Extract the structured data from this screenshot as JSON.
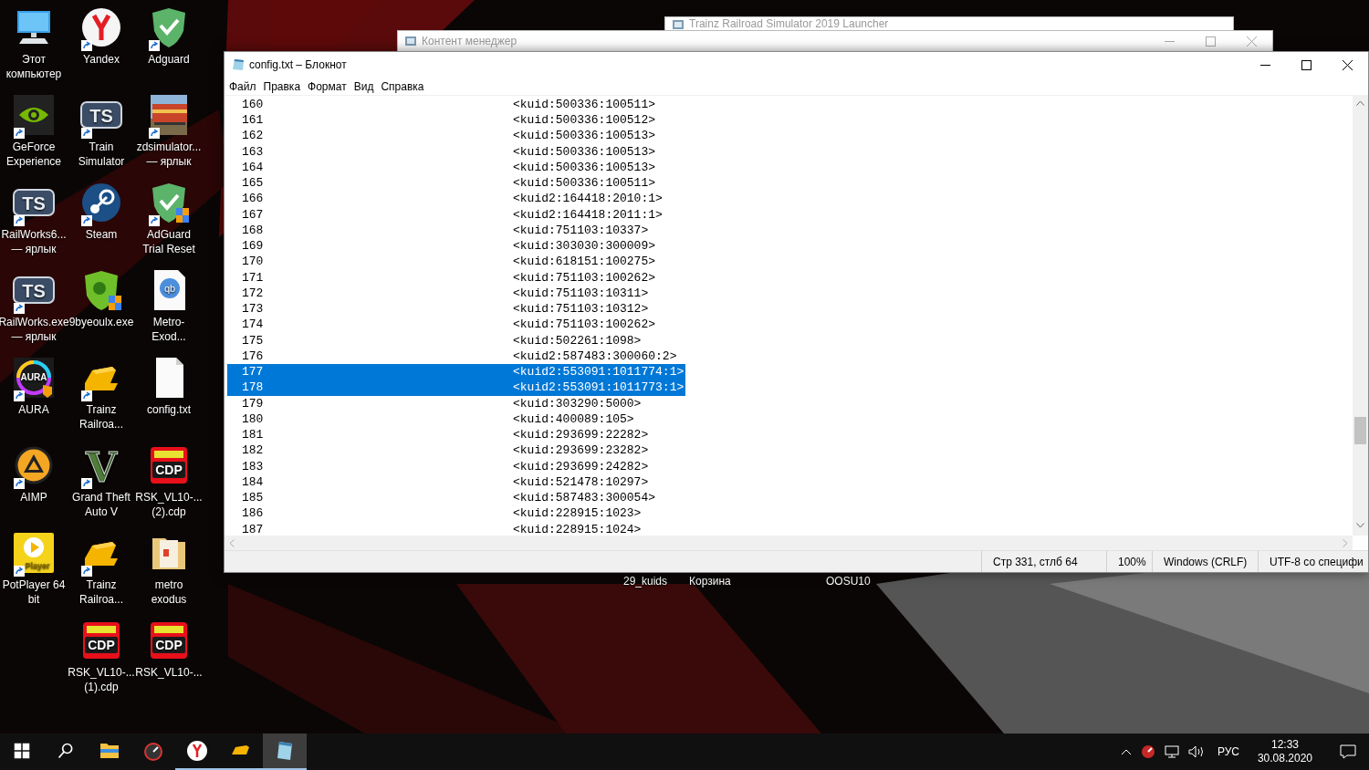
{
  "desktop": {
    "columns": [
      [
        {
          "label": "Этот компьютер",
          "kind": "computer",
          "shortcut": false
        },
        {
          "label": "GeForce Experience",
          "kind": "nvidia",
          "shortcut": true
        },
        {
          "label": "RailWorks6... — ярлык",
          "kind": "ts",
          "badge": "TS",
          "shortcut": true
        },
        {
          "label": "RailWorks.exe — ярлык",
          "kind": "ts",
          "badge": "TS",
          "shortcut": true
        },
        {
          "label": "AURA",
          "kind": "aura",
          "badge": "AURA",
          "shortcut": true
        },
        {
          "label": "AIMP",
          "kind": "aimp",
          "shortcut": true
        },
        {
          "label": "PotPlayer 64 bit",
          "kind": "potplayer",
          "badge": "Player",
          "shortcut": true
        }
      ],
      [
        {
          "label": "Yandex",
          "kind": "yandex",
          "shortcut": true
        },
        {
          "label": "Train Simulator",
          "kind": "ts",
          "badge": "TS",
          "shortcut": true
        },
        {
          "label": "Steam",
          "kind": "steam",
          "shortcut": true
        },
        {
          "label": "9byeoulx.exe",
          "kind": "drweb",
          "shortcut": false
        },
        {
          "label": "Trainz Railroa...",
          "kind": "trainz",
          "shortcut": true
        },
        {
          "label": "Grand Theft Auto V",
          "kind": "gta",
          "badge": "V",
          "shortcut": true
        },
        {
          "label": "Trainz Railroa...",
          "kind": "trainz",
          "shortcut": true
        },
        {
          "label": "RSK_VL10-... (1).cdp",
          "kind": "cdp",
          "badge": "CDP",
          "shortcut": false
        }
      ],
      [
        {
          "label": "Adguard",
          "kind": "adguard",
          "shortcut": true
        },
        {
          "label": "zdsimulator... — ярлык",
          "shortcut": true
        },
        {
          "label": "AdGuard Trial Reset",
          "kind": "adguard-uac",
          "shortcut": true
        },
        {
          "label": "Metro-Exod...",
          "kind": "qb",
          "badge": "qb",
          "shortcut": false
        },
        {
          "label": "config.txt",
          "kind": "textfile",
          "shortcut": false
        },
        {
          "label": "RSK_VL10-... (2).cdp",
          "kind": "cdp",
          "badge": "CDP",
          "shortcut": false
        },
        {
          "label": "metro exodus",
          "kind": "folder",
          "shortcut": false
        },
        {
          "label": "RSK_VL10-...",
          "kind": "cdp",
          "badge": "CDP",
          "shortcut": false
        }
      ]
    ],
    "hidden_labels": [
      "29_kuids",
      "Корзина",
      "OOSU10"
    ]
  },
  "background_windows": [
    {
      "title": "Trainz Railroad Simulator 2019 Launcher"
    },
    {
      "title": "Контент менеджер"
    }
  ],
  "notepad": {
    "title": "config.txt – Блокнот",
    "menu": [
      "Файл",
      "Правка",
      "Формат",
      "Вид",
      "Справка"
    ],
    "lines": [
      {
        "number": "160",
        "text": "<kuid:500336:100511>",
        "selected": false
      },
      {
        "number": "161",
        "text": "<kuid:500336:100512>",
        "selected": false
      },
      {
        "number": "162",
        "text": "<kuid:500336:100513>",
        "selected": false
      },
      {
        "number": "163",
        "text": "<kuid:500336:100513>",
        "selected": false
      },
      {
        "number": "164",
        "text": "<kuid:500336:100513>",
        "selected": false
      },
      {
        "number": "165",
        "text": "<kuid:500336:100511>",
        "selected": false
      },
      {
        "number": "166",
        "text": "<kuid2:164418:2010:1>",
        "selected": false
      },
      {
        "number": "167",
        "text": "<kuid2:164418:2011:1>",
        "selected": false
      },
      {
        "number": "168",
        "text": "<kuid:751103:10337>",
        "selected": false
      },
      {
        "number": "169",
        "text": "<kuid:303030:300009>",
        "selected": false
      },
      {
        "number": "170",
        "text": "<kuid:618151:100275>",
        "selected": false
      },
      {
        "number": "171",
        "text": "<kuid:751103:100262>",
        "selected": false
      },
      {
        "number": "172",
        "text": "<kuid:751103:10311>",
        "selected": false
      },
      {
        "number": "173",
        "text": "<kuid:751103:10312>",
        "selected": false
      },
      {
        "number": "174",
        "text": "<kuid:751103:100262>",
        "selected": false
      },
      {
        "number": "175",
        "text": "<kuid:502261:1098>",
        "selected": false
      },
      {
        "number": "176",
        "text": "<kuid2:587483:300060:2>",
        "selected": false
      },
      {
        "number": "177",
        "text": "<kuid2:553091:1011774:1>",
        "selected": true
      },
      {
        "number": "178",
        "text": "<kuid2:553091:1011773:1>",
        "selected": true
      },
      {
        "number": "179",
        "text": "<kuid:303290:5000>",
        "selected": false
      },
      {
        "number": "180",
        "text": "<kuid:400089:105>",
        "selected": false
      },
      {
        "number": "181",
        "text": "<kuid:293699:22282>",
        "selected": false
      },
      {
        "number": "182",
        "text": "<kuid:293699:23282>",
        "selected": false
      },
      {
        "number": "183",
        "text": "<kuid:293699:24282>",
        "selected": false
      },
      {
        "number": "184",
        "text": "<kuid:521478:10297>",
        "selected": false
      },
      {
        "number": "185",
        "text": "<kuid:587483:300054>",
        "selected": false
      },
      {
        "number": "186",
        "text": "<kuid:228915:1023>",
        "selected": false
      },
      {
        "number": "187",
        "text": "<kuid:228915:1024>",
        "selected": false
      }
    ],
    "status_bar": [
      "Стр 331, стлб 64",
      "100%",
      "Windows (CRLF)",
      "UTF-8 со специфи"
    ]
  },
  "taskbar": {
    "items": [
      {
        "kind": "start",
        "running": false,
        "selected": false
      },
      {
        "kind": "search",
        "running": false,
        "selected": false
      },
      {
        "kind": "explorer",
        "running": false,
        "selected": false
      },
      {
        "kind": "gpu",
        "running": false,
        "selected": false
      },
      {
        "kind": "yandex",
        "running": true,
        "selected": false
      },
      {
        "kind": "trainz",
        "running": true,
        "selected": false
      },
      {
        "kind": "notepad",
        "running": true,
        "selected": true
      }
    ],
    "language": "РУС",
    "time": "12:33",
    "date": "30.08.2020"
  }
}
